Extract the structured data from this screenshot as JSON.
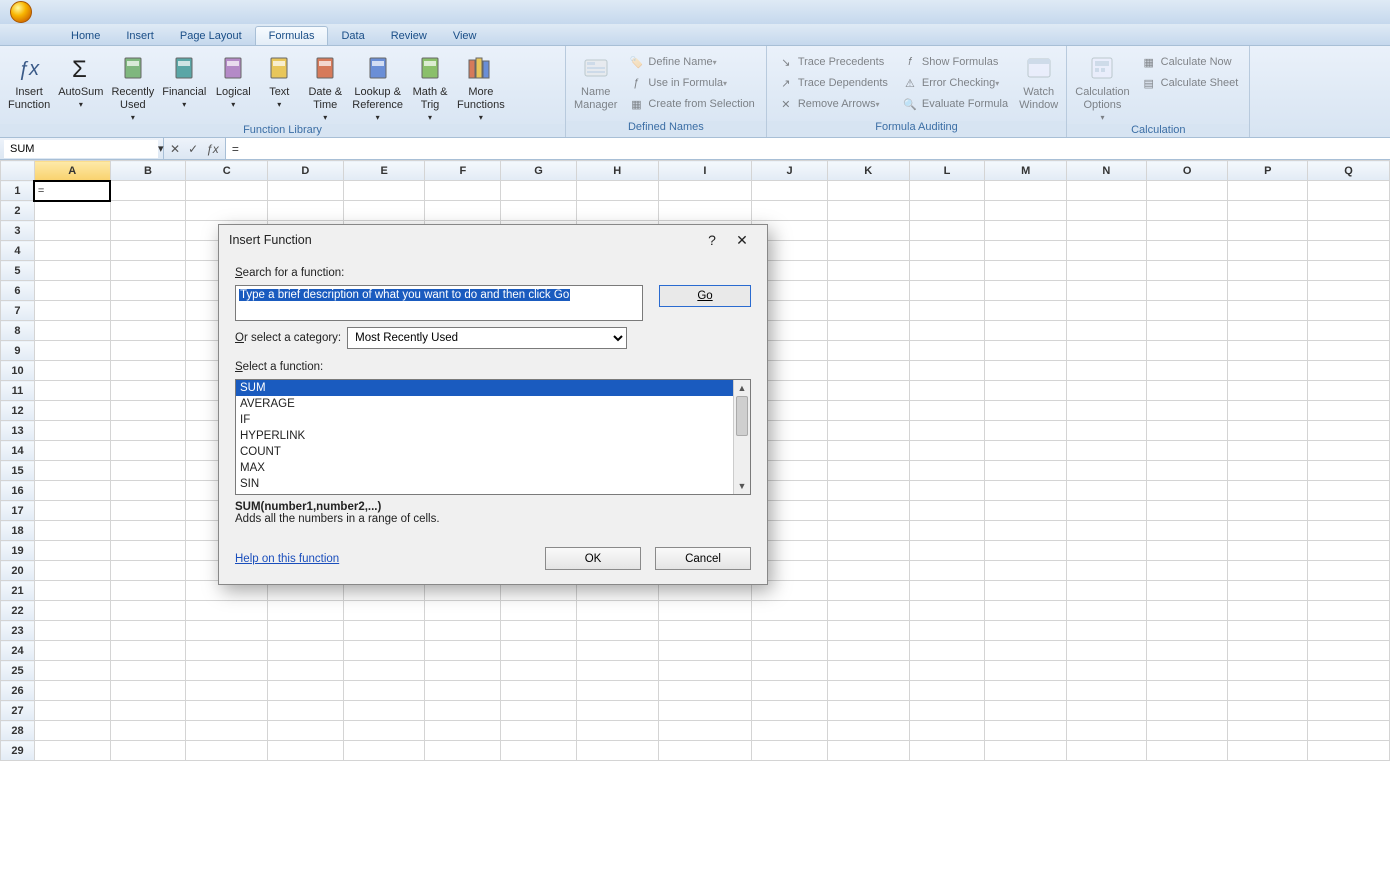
{
  "tabs": [
    "Home",
    "Insert",
    "Page Layout",
    "Formulas",
    "Data",
    "Review",
    "View"
  ],
  "active_tab": "Formulas",
  "ribbon": {
    "function_library": {
      "label": "Function Library",
      "items": {
        "insert_function": "Insert\nFunction",
        "autosum": "AutoSum",
        "recently_used": "Recently\nUsed",
        "financial": "Financial",
        "logical": "Logical",
        "text": "Text",
        "date_time": "Date &\nTime",
        "lookup_ref": "Lookup &\nReference",
        "math_trig": "Math &\nTrig",
        "more": "More\nFunctions"
      }
    },
    "defined_names": {
      "label": "Defined Names",
      "name_manager": "Name\nManager",
      "define_name": "Define Name",
      "use_in_formula": "Use in Formula",
      "create_from_selection": "Create from Selection"
    },
    "formula_auditing": {
      "label": "Formula Auditing",
      "trace_precedents": "Trace Precedents",
      "trace_dependents": "Trace Dependents",
      "remove_arrows": "Remove Arrows",
      "show_formulas": "Show Formulas",
      "error_checking": "Error Checking",
      "evaluate_formula": "Evaluate Formula",
      "watch_window": "Watch\nWindow"
    },
    "calculation": {
      "label": "Calculation",
      "calc_options": "Calculation\nOptions",
      "calc_now": "Calculate Now",
      "calc_sheet": "Calculate Sheet"
    }
  },
  "namebox_value": "SUM",
  "formula_value": "=",
  "columns": [
    "A",
    "B",
    "C",
    "D",
    "E",
    "F",
    "G",
    "H",
    "I",
    "J",
    "K",
    "L",
    "M",
    "N",
    "O",
    "P",
    "Q"
  ],
  "rows": 29,
  "cell_a1": "=",
  "dialog": {
    "title": "Insert Function",
    "search_label": "Search for a function:",
    "search_text": "Type a brief description of what you want to do and then click Go",
    "go": "Go",
    "category_label": "Or select a category:",
    "category_value": "Most Recently Used",
    "select_label": "Select a function:",
    "functions": [
      "SUM",
      "AVERAGE",
      "IF",
      "HYPERLINK",
      "COUNT",
      "MAX",
      "SIN"
    ],
    "selected_index": 0,
    "signature": "SUM(number1,number2,...)",
    "description": "Adds all the numbers in a range of cells.",
    "help": "Help on this function",
    "ok": "OK",
    "cancel": "Cancel"
  }
}
